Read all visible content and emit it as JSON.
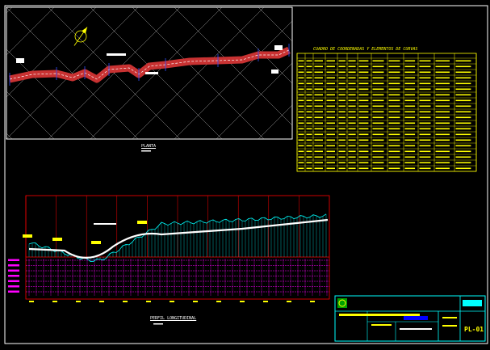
{
  "drawing": {
    "plan_caption": "PLANTA",
    "profile_caption": "PERFIL LONGITUDINAL",
    "table_title": "CUADRO DE COORDENADAS Y ELEMENTOS DE CURVAS",
    "sheet_number": "PL-01",
    "colors": {
      "background": "#000000",
      "frame": "#ffffff",
      "grid": "#c8c8c8",
      "road": "#c83232",
      "axis": "#ffffff",
      "table": "#ffff00",
      "profile_frame": "#ff0000",
      "profile_lines": "#ff00ff",
      "terrain": "#00ffff",
      "band_labels": "#ff00ff",
      "titleblock": "#00ffff"
    },
    "icons": {
      "north_arrow": "north-arrow-icon",
      "logo": "logo-icon"
    }
  }
}
